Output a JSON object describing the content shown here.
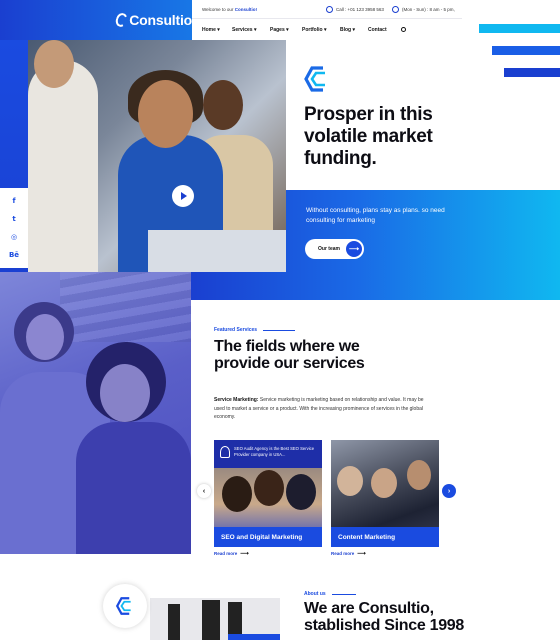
{
  "brand": {
    "name": "Consultio"
  },
  "topbar": {
    "welcome_prefix": "Welcome to our",
    "welcome_brand": "Consultio!",
    "call": "Call : +01 123 3958 563",
    "hours": "(Mon - Sun) : 8 am - 5 pm,"
  },
  "nav": {
    "items": [
      "Home",
      "Services",
      "Pages",
      "Portfolio",
      "Blog",
      "Contact"
    ]
  },
  "social": {
    "icons": [
      "facebook-icon",
      "twitter-icon",
      "instagram-icon",
      "behance-icon"
    ],
    "glyphs": [
      "f",
      "t",
      "◎",
      "Bē"
    ]
  },
  "hero": {
    "title": "Prosper in this volatile market funding.",
    "subtitle": "Without consulting, plans stay as plans. so need consulting for marketing",
    "button": "Our team"
  },
  "services": {
    "eyebrow": "Featured Services",
    "title": "The fields where we provide our services",
    "desc_lead": "Service Marketing:",
    "desc": "Service marketing is marketing based on relationship and value. It may be used to market a service or a product. With the increasing prominence of services in the global economy.",
    "cards": [
      {
        "top_text": "SEO Audit Agency is the Best SEO Service Provider company in USA...",
        "label": "SEO and Digital Marketing",
        "readmore": "Read more"
      },
      {
        "label": "Content Marketing",
        "readmore": "Read more"
      }
    ]
  },
  "about": {
    "eyebrow": "About us",
    "title": "We are Consultio, stablished Since 1998"
  },
  "colors": {
    "primary": "#1a4be0",
    "accent": "#10b8f0",
    "dark": "#0d0d14"
  }
}
